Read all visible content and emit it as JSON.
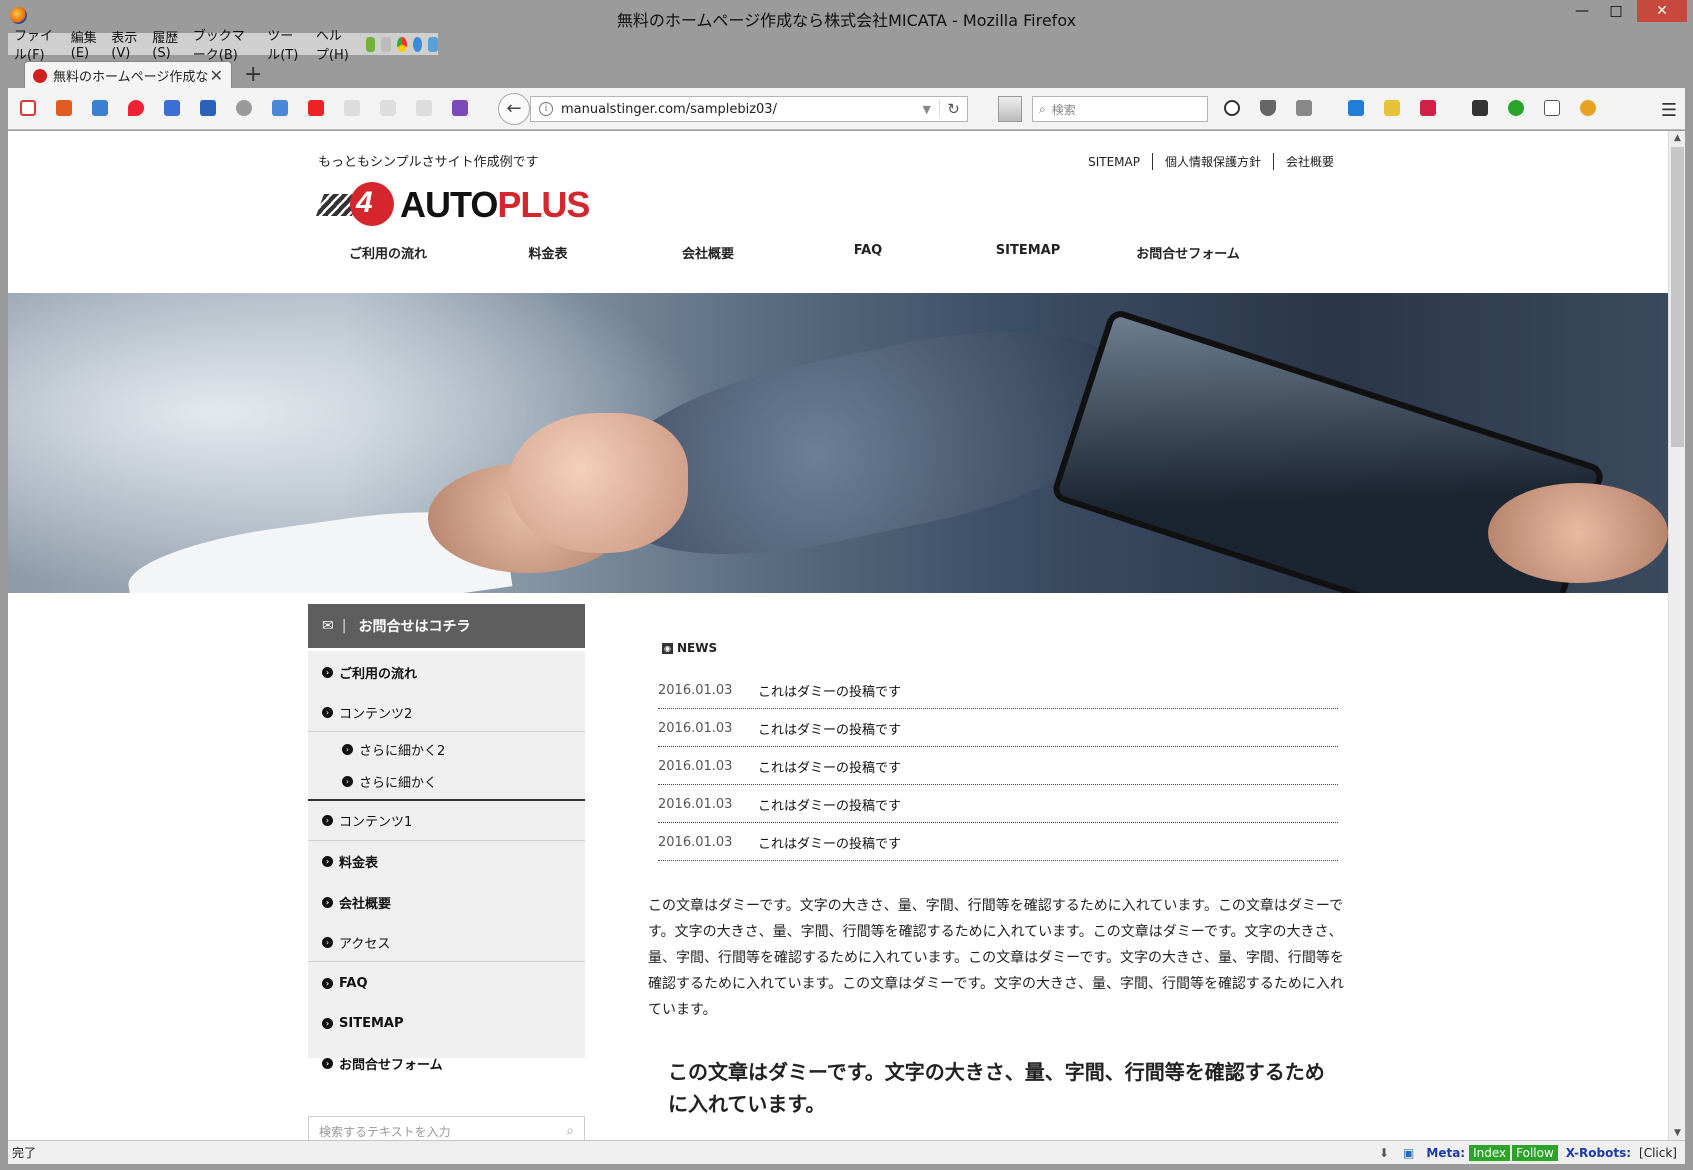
{
  "window": {
    "title": "無料のホームページ作成なら株式会社MICATA - Mozilla Firefox",
    "min": "—",
    "max": "□",
    "close": "✕"
  },
  "menubar": {
    "items": [
      "ファイル(F)",
      "編集(E)",
      "表示(V)",
      "履歴(S)",
      "ブックマーク(B)",
      "ツール(T)",
      "ヘルプ(H)"
    ]
  },
  "tab": {
    "title": "無料のホームページ作成なら...",
    "close": "✕",
    "new_tab": "+"
  },
  "navbar": {
    "back": "←",
    "info": "i",
    "url": "manualstinger.com/samplebiz03/",
    "dropdown": "▼",
    "reload": "↻",
    "search_placeholder": "検索",
    "menu": "☰"
  },
  "site": {
    "tagline": "もっともシンプルさサイト作成例です",
    "logo": {
      "mark": "4",
      "word1": "AUTO",
      "word2": "PLUS"
    },
    "top_links": [
      "SITEMAP",
      "個人情報保護方針",
      "会社概要"
    ],
    "global_nav": [
      "ご利用の流れ",
      "料金表",
      "会社概要",
      "FAQ",
      "SITEMAP",
      "お問合せフォーム"
    ],
    "sidebar": {
      "header": "お問合せはコチラ",
      "items": [
        {
          "label": "ご利用の流れ",
          "bold": true
        },
        {
          "label": "コンテンツ2",
          "bold": false
        },
        {
          "label": "さらに細かく2",
          "bold": false
        },
        {
          "label": "さらに細かく",
          "bold": false
        },
        {
          "label": "コンテンツ1",
          "bold": false
        },
        {
          "label": "料金表",
          "bold": true
        },
        {
          "label": "会社概要",
          "bold": true
        },
        {
          "label": "アクセス",
          "bold": false
        },
        {
          "label": "FAQ",
          "bold": true
        },
        {
          "label": "SITEMAP",
          "bold": true
        },
        {
          "label": "お問合せフォーム",
          "bold": true
        }
      ],
      "search_placeholder": "検索するテキストを入力"
    },
    "news": {
      "heading": "NEWS",
      "rows": [
        {
          "date": "2016.01.03",
          "title": "これはダミーの投稿です"
        },
        {
          "date": "2016.01.03",
          "title": "これはダミーの投稿です"
        },
        {
          "date": "2016.01.03",
          "title": "これはダミーの投稿です"
        },
        {
          "date": "2016.01.03",
          "title": "これはダミーの投稿です"
        },
        {
          "date": "2016.01.03",
          "title": "これはダミーの投稿です"
        }
      ]
    },
    "body_text": "この文章はダミーです。文字の大きさ、量、字間、行間等を確認するために入れています。この文章はダミーです。文字の大きさ、量、字間、行間等を確認するために入れています。この文章はダミーです。文字の大きさ、量、字間、行間等を確認するために入れています。この文章はダミーです。文字の大きさ、量、字間、行間等を確認するために入れています。この文章はダミーです。文字の大きさ、量、字間、行間等を確認するために入れています。",
    "heading_text": "この文章はダミーです。文字の大きさ、量、字間、行間等を確認するために入れています。"
  },
  "statusbar": {
    "status": "完了",
    "meta_label": "Meta:",
    "index": "Index",
    "follow": "Follow",
    "xrobots_label": "X-Robots:",
    "click": "[Click]"
  },
  "colors": {
    "brand_red": "#d4262c",
    "sidebar_header": "#5e5e5e",
    "sidebar_bg": "#efefef",
    "status_green": "#2aa52a"
  }
}
